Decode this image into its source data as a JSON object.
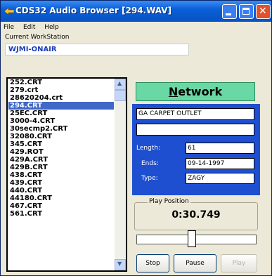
{
  "window": {
    "title": "CDS32 Audio Browser [294.WAV]"
  },
  "menu": {
    "items": [
      "File",
      "Edit",
      "Help"
    ]
  },
  "workstation": {
    "label": "Current WorkStation",
    "value": "WJMI-ONAIR"
  },
  "file_list": {
    "items": [
      "252.CRT",
      "279.crt",
      "28620204.crt",
      "294.CRT",
      "25EC.CRT",
      "3000-4.CRT",
      "30secmp2.CRT",
      "32080.CRT",
      "345.CRT",
      "429.ROT",
      "429A.CRT",
      "429B.CRT",
      "438.CRT",
      "439.CRT",
      "440.CRT",
      "44180.CRT",
      "467.CRT",
      "561.CRT"
    ],
    "selected": "294.CRT"
  },
  "network_button": {
    "first_letter": "N",
    "rest": "etwork"
  },
  "info": {
    "title": "GA CARPET OUTLET",
    "blank": "",
    "length_label": "Length:",
    "length": "61",
    "ends_label": "Ends:",
    "ends": "09-14-1997",
    "type_label": "Type:",
    "type": "ZAGY"
  },
  "playback": {
    "position_label": "Play Position",
    "position": "0:30.749",
    "progress": 0.5
  },
  "buttons": {
    "stop": "Stop",
    "pause": "Pause",
    "play": "Play"
  }
}
